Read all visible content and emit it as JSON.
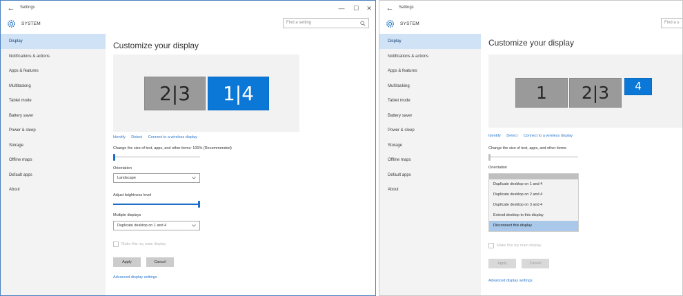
{
  "left": {
    "titlebar": {
      "back": "←",
      "title": "Settings",
      "minimize": "—",
      "maximize": "☐",
      "close": "✕"
    },
    "header": {
      "system": "SYSTEM",
      "search_placeholder": "Find a setting"
    },
    "sidebar": [
      "Display",
      "Notifications & actions",
      "Apps & features",
      "Multitasking",
      "Tablet mode",
      "Battery saver",
      "Power & sleep",
      "Storage",
      "Offline maps",
      "Default apps",
      "About"
    ],
    "content": {
      "heading": "Customize your display",
      "monitors": [
        {
          "label": "2|3",
          "color": "#9a9a9a",
          "selected": false
        },
        {
          "label": "1|4",
          "color": "#0b78d7",
          "selected": true
        }
      ],
      "links": [
        "Identify",
        "Detect",
        "Connect to a wireless display"
      ],
      "scale_label": "Change the size of text, apps, and other items: 100% (Recommended)",
      "scale_value_pct": 0,
      "orientation_label": "Orientation",
      "orientation_value": "Landscape",
      "brightness_label": "Adjust brightness level",
      "brightness_value_pct": 100,
      "multiple_label": "Multiple displays",
      "multiple_value": "Duplicate desktop on 1 and 4",
      "main_display_label": "Make this my main display",
      "apply": "Apply",
      "cancel": "Cancel",
      "advanced": "Advanced display settings"
    }
  },
  "right": {
    "titlebar": {
      "back": "←",
      "title": "Settings"
    },
    "header": {
      "system": "SYSTEM",
      "search_placeholder": "Find a s"
    },
    "sidebar": [
      "Display",
      "Notifications & actions",
      "Apps & features",
      "Multitasking",
      "Tablet mode",
      "Battery saver",
      "Power & sleep",
      "Storage",
      "Offline maps",
      "Default apps",
      "About"
    ],
    "content": {
      "heading": "Customize your display",
      "monitors": [
        {
          "label": "1",
          "color": "#9a9a9a",
          "selected": false
        },
        {
          "label": "2|3",
          "color": "#9a9a9a",
          "selected": false
        },
        {
          "label": "4",
          "color": "#0b78d7",
          "selected": true
        }
      ],
      "links": [
        "Identify",
        "Detect",
        "Connect to a wireless display"
      ],
      "scale_label": "Change the size of text, apps, and other items:",
      "orientation_label": "Orientation",
      "dropdown_options": [
        "Duplicate desktop on 1 and 4",
        "Duplicate desktop on 2 and 4",
        "Duplicate desktop on 3 and 4",
        "Extend desktop to this display",
        "Disconnect this display"
      ],
      "dropdown_highlighted": "Disconnect this display",
      "main_display_label": "Make this my main display",
      "apply": "Apply",
      "cancel": "Cancel",
      "advanced": "Advanced display settings"
    }
  },
  "colors": {
    "accent": "#0b78d7",
    "selected_nav": "#cfe2f6",
    "link": "#2a78cc"
  }
}
